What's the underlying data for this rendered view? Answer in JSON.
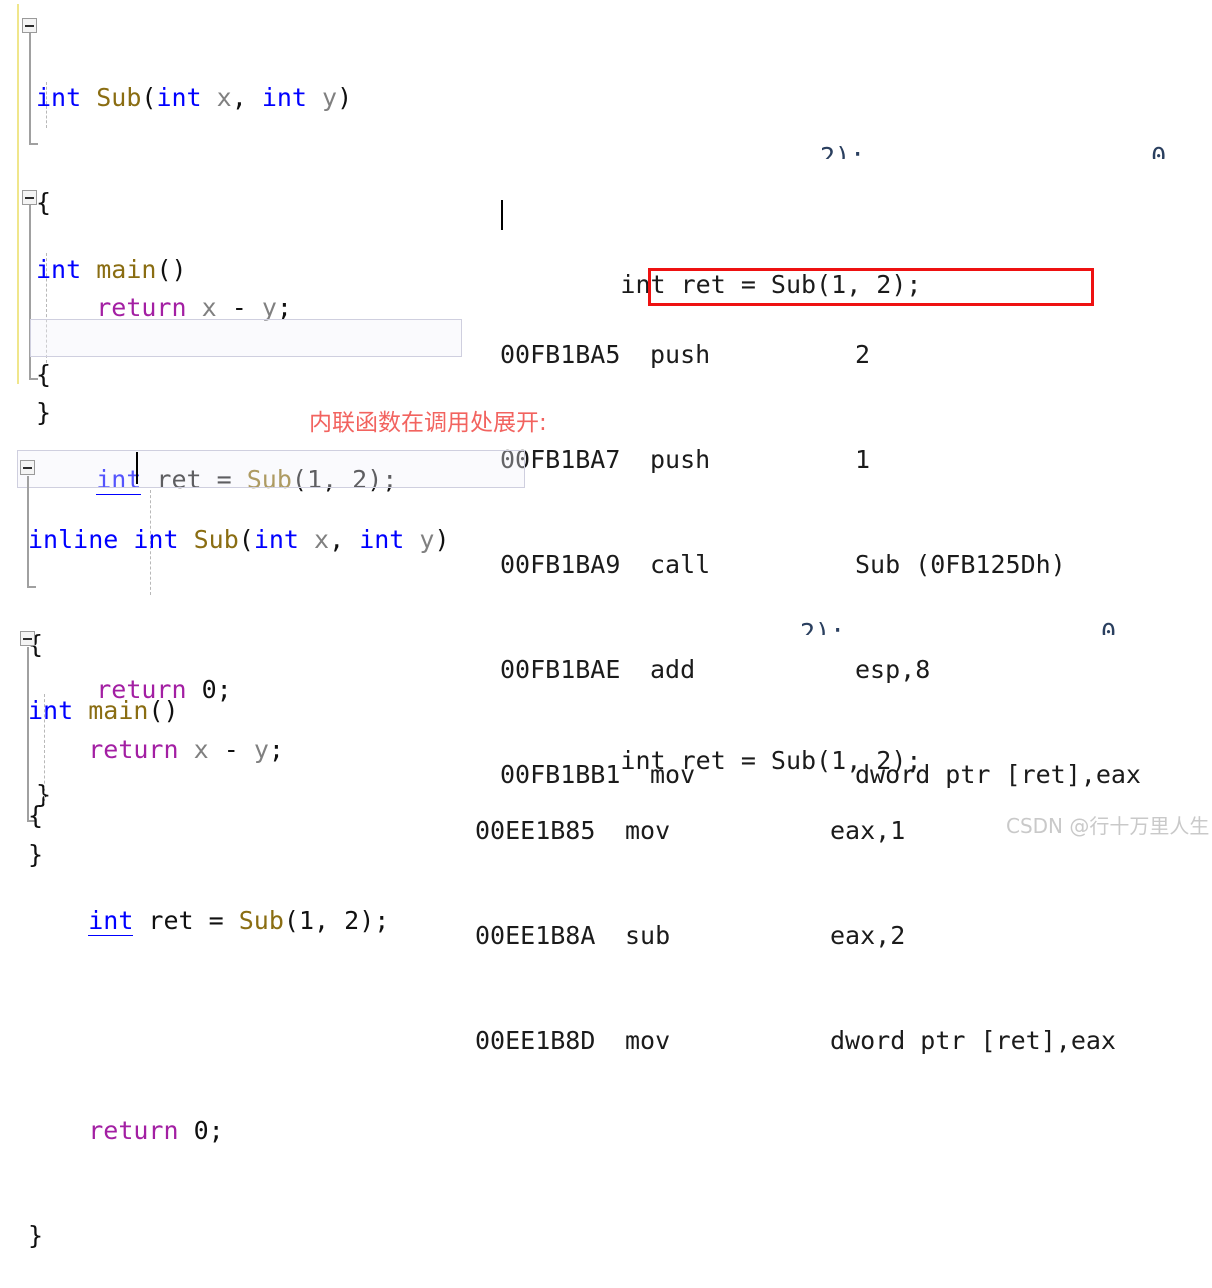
{
  "page": {
    "watermark": "CSDN @行十万里人生",
    "annotation_note": "内联函数在调用处展开:",
    "accent_red": "#ee1111",
    "note_color": "#f2635f",
    "keyword_color": "#0000ff",
    "function_color": "#8a6d12",
    "return_keyword_color": "#a31fa3",
    "identifier_color": "#808080",
    "change_bar_color": "#f0e68c"
  },
  "editor_top": {
    "name": "non-inline-sub-definition",
    "lines": [
      {
        "tokens": [
          {
            "t": "int",
            "c": "kw"
          },
          {
            "t": " ",
            "c": "pl"
          },
          {
            "t": "Sub",
            "c": "fn"
          },
          {
            "t": "(",
            "c": "pl"
          },
          {
            "t": "int",
            "c": "kw"
          },
          {
            "t": " ",
            "c": "pl"
          },
          {
            "t": "x",
            "c": "id"
          },
          {
            "t": ", ",
            "c": "pl"
          },
          {
            "t": "int",
            "c": "kw"
          },
          {
            "t": " ",
            "c": "pl"
          },
          {
            "t": "y",
            "c": "id"
          },
          {
            "t": ")",
            "c": "pl"
          }
        ]
      },
      {
        "tokens": [
          {
            "t": "{",
            "c": "pl"
          }
        ]
      },
      {
        "tokens": [
          {
            "t": "    ",
            "c": "pl"
          },
          {
            "t": "return",
            "c": "ret"
          },
          {
            "t": " ",
            "c": "pl"
          },
          {
            "t": "x",
            "c": "id"
          },
          {
            "t": " - ",
            "c": "pl"
          },
          {
            "t": "y",
            "c": "id"
          },
          {
            "t": ";",
            "c": "pl"
          }
        ]
      },
      {
        "tokens": [
          {
            "t": "}",
            "c": "pl"
          }
        ]
      }
    ]
  },
  "editor_main_top": {
    "name": "non-inline-main",
    "lines": [
      {
        "tokens": [
          {
            "t": "int",
            "c": "kw"
          },
          {
            "t": " ",
            "c": "pl"
          },
          {
            "t": "main",
            "c": "fn"
          },
          {
            "t": "()",
            "c": "pl"
          }
        ]
      },
      {
        "tokens": [
          {
            "t": "{",
            "c": "pl"
          }
        ]
      },
      {
        "tokens": [
          {
            "t": "    ",
            "c": "pl"
          },
          {
            "t": "int",
            "c": "kw-u"
          },
          {
            "t": " ret = ",
            "c": "pl"
          },
          {
            "t": "Sub",
            "c": "fn"
          },
          {
            "t": "(",
            "c": "pl"
          },
          {
            "t": "1",
            "c": "num"
          },
          {
            "t": ", ",
            "c": "pl"
          },
          {
            "t": "2",
            "c": "num"
          },
          {
            "t": ");",
            "c": "pl"
          }
        ]
      },
      {
        "tokens": []
      },
      {
        "tokens": [
          {
            "t": "    ",
            "c": "pl"
          },
          {
            "t": "return",
            "c": "ret"
          },
          {
            "t": " ",
            "c": "pl"
          },
          {
            "t": "0",
            "c": "num"
          },
          {
            "t": ";",
            "c": "pl"
          }
        ]
      },
      {
        "tokens": [
          {
            "t": "}",
            "c": "pl"
          }
        ]
      }
    ]
  },
  "editor_inline_sub": {
    "name": "inline-sub-definition",
    "lines": [
      {
        "tokens": [
          {
            "t": "inline",
            "c": "kw"
          },
          {
            "t": " ",
            "c": "pl"
          },
          {
            "t": "int",
            "c": "kw"
          },
          {
            "t": " ",
            "c": "pl"
          },
          {
            "t": "Sub",
            "c": "fn"
          },
          {
            "t": "(",
            "c": "pl"
          },
          {
            "t": "int",
            "c": "kw"
          },
          {
            "t": " ",
            "c": "pl"
          },
          {
            "t": "x",
            "c": "id"
          },
          {
            "t": ", ",
            "c": "pl"
          },
          {
            "t": "int",
            "c": "kw"
          },
          {
            "t": " ",
            "c": "pl"
          },
          {
            "t": "y",
            "c": "id"
          },
          {
            "t": ")",
            "c": "pl"
          }
        ]
      },
      {
        "tokens": [
          {
            "t": "{",
            "c": "pl"
          }
        ]
      },
      {
        "tokens": [
          {
            "t": "    ",
            "c": "pl"
          },
          {
            "t": "return",
            "c": "ret"
          },
          {
            "t": " ",
            "c": "pl"
          },
          {
            "t": "x",
            "c": "id"
          },
          {
            "t": " - ",
            "c": "pl"
          },
          {
            "t": "y",
            "c": "id"
          },
          {
            "t": ";",
            "c": "pl"
          }
        ]
      },
      {
        "tokens": [
          {
            "t": "}",
            "c": "pl"
          }
        ]
      }
    ]
  },
  "editor_main_bottom": {
    "name": "inline-main",
    "lines": [
      {
        "tokens": [
          {
            "t": "int",
            "c": "kw"
          },
          {
            "t": " ",
            "c": "pl"
          },
          {
            "t": "main",
            "c": "fn"
          },
          {
            "t": "()",
            "c": "pl"
          }
        ]
      },
      {
        "tokens": [
          {
            "t": "{",
            "c": "pl"
          }
        ]
      },
      {
        "tokens": [
          {
            "t": "    ",
            "c": "pl"
          },
          {
            "t": "int",
            "c": "kw-u"
          },
          {
            "t": " ret = ",
            "c": "pl"
          },
          {
            "t": "Sub",
            "c": "fn"
          },
          {
            "t": "(",
            "c": "pl"
          },
          {
            "t": "1",
            "c": "num"
          },
          {
            "t": ", ",
            "c": "pl"
          },
          {
            "t": "2",
            "c": "num"
          },
          {
            "t": ");",
            "c": "pl"
          }
        ]
      },
      {
        "tokens": []
      },
      {
        "tokens": [
          {
            "t": "    ",
            "c": "pl"
          },
          {
            "t": "return",
            "c": "ret"
          },
          {
            "t": " ",
            "c": "pl"
          },
          {
            "t": "0",
            "c": "num"
          },
          {
            "t": ";",
            "c": "pl"
          }
        ]
      },
      {
        "tokens": [
          {
            "t": "}",
            "c": "pl"
          }
        ]
      }
    ]
  },
  "disasm_top": {
    "name": "disassembly-non-inline",
    "source_line": "    int ret = Sub(1, 2);",
    "rows": [
      {
        "addr": "00FB1BA5",
        "op": "push",
        "args": "2",
        "boxed": false
      },
      {
        "addr": "00FB1BA7",
        "op": "push",
        "args": "1",
        "boxed": false
      },
      {
        "addr": "00FB1BA9",
        "op": "call",
        "args": "Sub (0FB125Dh)",
        "boxed": true
      },
      {
        "addr": "00FB1BAE",
        "op": "add",
        "args": "esp,8",
        "boxed": false
      },
      {
        "addr": "00FB1BB1",
        "op": "mov",
        "args": "dword ptr [ret],eax",
        "boxed": false
      }
    ]
  },
  "disasm_bottom": {
    "name": "disassembly-inline",
    "source_line": "    int ret = Sub(1, 2);",
    "rows": [
      {
        "addr": "00EE1B85",
        "op": "mov",
        "args": "eax,1",
        "boxed": false
      },
      {
        "addr": "00EE1B8A",
        "op": "sub",
        "args": "eax,2",
        "boxed": false
      },
      {
        "addr": "00EE1B8D",
        "op": "mov",
        "args": "dword ptr [ret],eax",
        "boxed": false
      }
    ]
  }
}
